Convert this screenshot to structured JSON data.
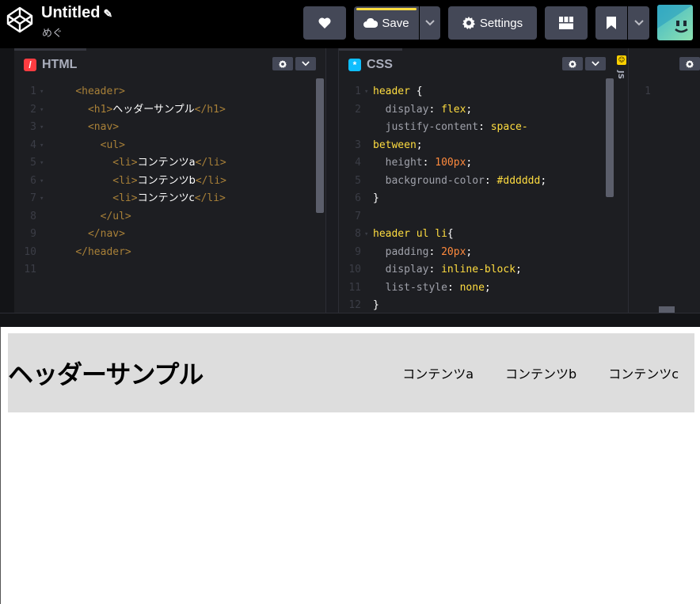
{
  "topbar": {
    "title": "Untitled",
    "edit_icon": "pencil-icon",
    "author": "めぐ",
    "save_label": "Save",
    "settings_label": "Settings",
    "accent_color": "#ffdd40"
  },
  "editors": {
    "html": {
      "label": "HTML",
      "icon_glyph": "/",
      "icon_color": "#ff3c41",
      "line_numbers": [
        "1",
        "2",
        "3",
        "4",
        "5",
        "6",
        "7",
        "8",
        "9",
        "10",
        "11"
      ]
    },
    "css": {
      "label": "CSS",
      "icon_glyph": "*",
      "icon_color": "#0ebeff",
      "line_numbers": [
        "1",
        "2",
        "",
        "3",
        "4",
        "5",
        "6",
        "7",
        "8",
        "9",
        "10",
        "11",
        "12"
      ]
    },
    "js": {
      "label": "JS",
      "icon_glyph": "☺",
      "icon_color": "#fcd000",
      "line_numbers": [
        "1"
      ]
    },
    "html_code": [
      {
        "indent": "    ",
        "parts": [
          [
            "tag",
            "<header>"
          ]
        ]
      },
      {
        "indent": "      ",
        "parts": [
          [
            "tag",
            "<h1>"
          ],
          [
            "txt",
            "ヘッダーサンプル"
          ],
          [
            "tag",
            "</h1>"
          ]
        ]
      },
      {
        "indent": "      ",
        "parts": [
          [
            "tag",
            "<nav>"
          ]
        ]
      },
      {
        "indent": "        ",
        "parts": [
          [
            "tag",
            "<ul>"
          ]
        ]
      },
      {
        "indent": "          ",
        "parts": [
          [
            "tag",
            "<li>"
          ],
          [
            "txt",
            "コンテンツa"
          ],
          [
            "tag",
            "</li>"
          ]
        ]
      },
      {
        "indent": "          ",
        "parts": [
          [
            "tag",
            "<li>"
          ],
          [
            "txt",
            "コンテンツb"
          ],
          [
            "tag",
            "</li>"
          ]
        ]
      },
      {
        "indent": "          ",
        "parts": [
          [
            "tag",
            "<li>"
          ],
          [
            "txt",
            "コンテンツc"
          ],
          [
            "tag",
            "</li>"
          ]
        ]
      },
      {
        "indent": "        ",
        "parts": [
          [
            "tag",
            "</ul>"
          ]
        ]
      },
      {
        "indent": "      ",
        "parts": [
          [
            "tag",
            "</nav>"
          ]
        ]
      },
      {
        "indent": "    ",
        "parts": [
          [
            "tag",
            "</header>"
          ]
        ]
      },
      {
        "indent": "",
        "parts": []
      }
    ],
    "css_code": [
      {
        "indent": "",
        "parts": [
          [
            "sel",
            "header"
          ],
          [
            "punc",
            " {"
          ]
        ]
      },
      {
        "indent": "  ",
        "parts": [
          [
            "prop",
            "display"
          ],
          [
            "punc",
            ": "
          ],
          [
            "val",
            "flex"
          ],
          [
            "punc",
            ";"
          ]
        ]
      },
      {
        "indent": "  ",
        "parts": [
          [
            "prop",
            "justify-content"
          ],
          [
            "punc",
            ": "
          ],
          [
            "val",
            "space-"
          ]
        ]
      },
      {
        "indent": "",
        "parts": [
          [
            "val",
            "between"
          ],
          [
            "punc",
            ";"
          ]
        ]
      },
      {
        "indent": "  ",
        "parts": [
          [
            "prop",
            "height"
          ],
          [
            "punc",
            ": "
          ],
          [
            "num",
            "100px"
          ],
          [
            "punc",
            ";"
          ]
        ]
      },
      {
        "indent": "  ",
        "parts": [
          [
            "prop",
            "background-color"
          ],
          [
            "punc",
            ": "
          ],
          [
            "val",
            "#dddddd"
          ],
          [
            "punc",
            ";"
          ]
        ]
      },
      {
        "indent": "",
        "parts": [
          [
            "punc",
            "}"
          ]
        ]
      },
      {
        "indent": "",
        "parts": []
      },
      {
        "indent": "",
        "parts": [
          [
            "sel",
            "header ul li"
          ],
          [
            "punc",
            "{"
          ]
        ]
      },
      {
        "indent": "  ",
        "parts": [
          [
            "prop",
            "padding"
          ],
          [
            "punc",
            ": "
          ],
          [
            "num",
            "20px"
          ],
          [
            "punc",
            ";"
          ]
        ]
      },
      {
        "indent": "  ",
        "parts": [
          [
            "prop",
            "display"
          ],
          [
            "punc",
            ": "
          ],
          [
            "val",
            "inline-block"
          ],
          [
            "punc",
            ";"
          ]
        ]
      },
      {
        "indent": "  ",
        "parts": [
          [
            "prop",
            "list-style"
          ],
          [
            "punc",
            ": "
          ],
          [
            "val",
            "none"
          ],
          [
            "punc",
            ";"
          ]
        ]
      },
      {
        "indent": "",
        "parts": [
          [
            "punc",
            "}"
          ]
        ]
      }
    ]
  },
  "preview": {
    "title": "ヘッダーサンプル",
    "nav_items": [
      "コンテンツa",
      "コンテンツb",
      "コンテンツc"
    ],
    "header_bg": "#dddddd"
  }
}
